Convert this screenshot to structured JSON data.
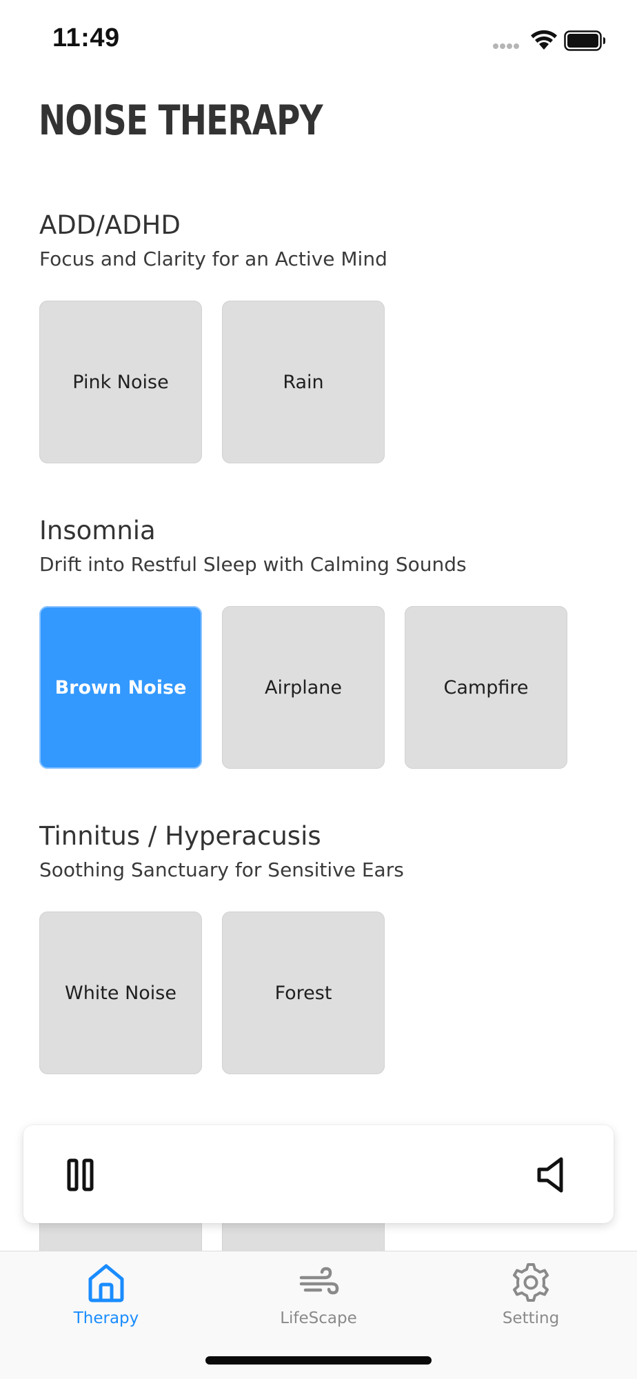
{
  "status_bar": {
    "time": "11:49"
  },
  "header": {
    "title": "NOISE THERAPY"
  },
  "sections": [
    {
      "title": "ADD/ADHD",
      "subtitle": "Focus and Clarity for an Active Mind",
      "cards": [
        {
          "label": "Pink Noise",
          "selected": false
        },
        {
          "label": "Rain",
          "selected": false
        }
      ]
    },
    {
      "title": "Insomnia",
      "subtitle": "Drift into Restful Sleep with Calming Sounds",
      "cards": [
        {
          "label": "Brown Noise",
          "selected": true
        },
        {
          "label": "Airplane",
          "selected": false
        },
        {
          "label": "Campfire",
          "selected": false
        }
      ]
    },
    {
      "title": "Tinnitus / Hyperacusis",
      "subtitle": "Soothing Sanctuary for Sensitive Ears",
      "cards": [
        {
          "label": "White Noise",
          "selected": false
        },
        {
          "label": "Forest",
          "selected": false
        }
      ]
    }
  ],
  "player": {
    "pause_icon": "pause-icon",
    "volume_icon": "speaker-icon"
  },
  "tab_bar": {
    "tabs": [
      {
        "label": "Therapy",
        "icon": "home-icon",
        "active": true
      },
      {
        "label": "LifeScape",
        "icon": "wind-icon",
        "active": false
      },
      {
        "label": "Setting",
        "icon": "gear-icon",
        "active": false
      }
    ]
  },
  "colors": {
    "accent": "#3399ff",
    "tab_active": "#1a8cff",
    "card_bg": "#dedede",
    "title": "#333333"
  }
}
